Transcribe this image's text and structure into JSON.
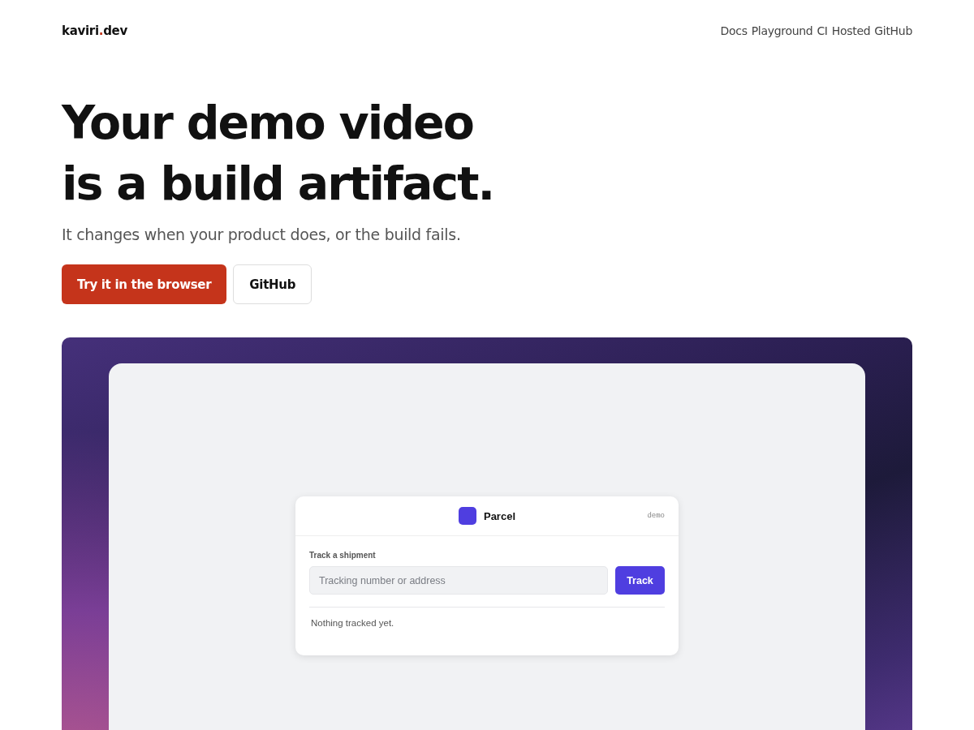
{
  "header": {
    "logo": [
      {
        "text": "kaviri",
        "accent": false
      },
      {
        "text": ".",
        "accent": true
      },
      {
        "text": "dev",
        "accent": false
      }
    ],
    "nav": [
      "Docs",
      "Playground",
      "CI",
      "Hosted",
      "GitHub"
    ]
  },
  "hero": {
    "title_lines": [
      "Your demo video",
      "is a build artifact."
    ],
    "subtitle": "It changes when your product does, or the build fails.",
    "buttons": [
      {
        "label": "Try it in the browser",
        "kind": "primary"
      },
      {
        "label": "GitHub",
        "kind": "secondary"
      }
    ]
  },
  "demo": {
    "app_name": "Parcel",
    "badge": "demo",
    "section_label": "Track a shipment",
    "placeholder": "Tracking number or address",
    "button": "Track",
    "empty_message": "Nothing tracked yet."
  }
}
